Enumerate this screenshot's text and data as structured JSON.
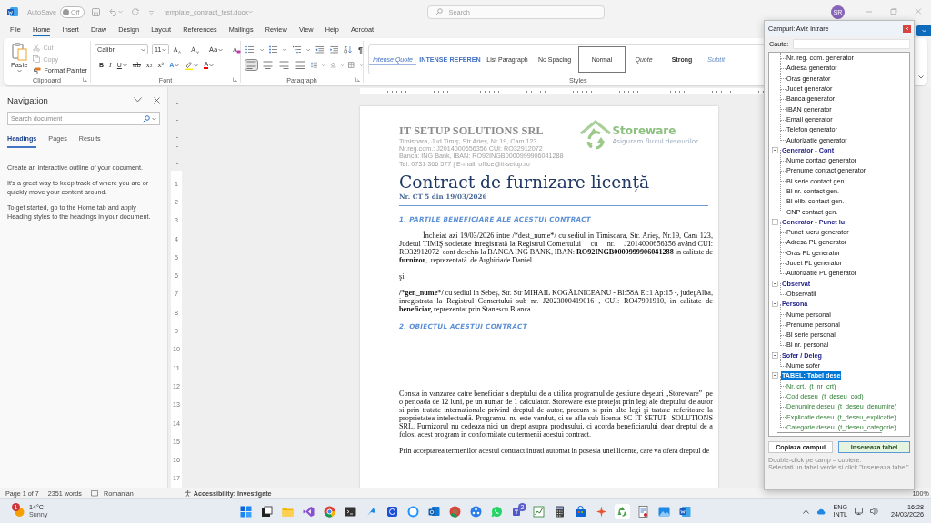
{
  "title_bar": {
    "autosave_label": "AutoSave",
    "autosave": {
      "label": "Off",
      "on": false
    },
    "file_name": "template_contract_test.docx",
    "search_placeholder": "Search",
    "avatar": "SR"
  },
  "menu_tabs": [
    {
      "label": "File",
      "selected": false
    },
    {
      "label": "Home",
      "selected": true
    },
    {
      "label": "Insert",
      "selected": false
    },
    {
      "label": "Draw",
      "selected": false
    },
    {
      "label": "Design",
      "selected": false
    },
    {
      "label": "Layout",
      "selected": false
    },
    {
      "label": "References",
      "selected": false
    },
    {
      "label": "Mailings",
      "selected": false
    },
    {
      "label": "Review",
      "selected": false
    },
    {
      "label": "View",
      "selected": false
    },
    {
      "label": "Help",
      "selected": false
    },
    {
      "label": "Acrobat",
      "selected": false
    }
  ],
  "ribbon": {
    "clipboard": {
      "paste": "Paste",
      "tools": [
        {
          "label": "Cut",
          "kind": "cut",
          "disabled": true
        },
        {
          "label": "Copy",
          "kind": "copy",
          "disabled": true
        },
        {
          "label": "Format Painter",
          "kind": "painter",
          "disabled": false
        }
      ],
      "group_label": "Clipboard"
    },
    "font": {
      "font_name": "Calibri",
      "font_size": "11",
      "tools": [
        {
          "label": "A",
          "kind": "grow"
        },
        {
          "label": "A",
          "kind": "shrink"
        },
        {
          "label": "Aa",
          "kind": "case"
        },
        {
          "label": "A",
          "kind": "clear"
        }
      ],
      "format": [
        {
          "label": "B",
          "kind": "bold"
        },
        {
          "label": "I",
          "kind": "italic"
        },
        {
          "label": "U",
          "kind": "underline"
        },
        {
          "label": "ab",
          "kind": "strike"
        },
        {
          "label": "x₂",
          "kind": "sub"
        },
        {
          "label": "x²",
          "kind": "sup"
        },
        {
          "label": "A",
          "kind": "effects"
        },
        {
          "kind": "highlight"
        },
        {
          "label": "A",
          "kind": "color"
        }
      ],
      "group_label": "Font"
    },
    "paragraph": {
      "pilcrow": "¶",
      "alignments": [
        {
          "kind": "left",
          "selected": true
        },
        {
          "kind": "center",
          "selected": false
        },
        {
          "kind": "right",
          "selected": false
        },
        {
          "kind": "justify",
          "selected": false
        }
      ],
      "group_label": "Paragraph"
    },
    "styles": {
      "items": [
        {
          "label": "Intense Quote",
          "kind": "intense-quote",
          "selected": false
        },
        {
          "label": "INTENSE REFEREN",
          "kind": "intense-reference",
          "selected": false
        },
        {
          "label": "List Paragraph",
          "kind": "plain",
          "selected": false
        },
        {
          "label": "No Spacing",
          "kind": "plain",
          "selected": false
        },
        {
          "label": "Normal",
          "kind": "plain",
          "selected": true
        },
        {
          "label": "Quote",
          "kind": "quote",
          "selected": false
        },
        {
          "label": "Strong",
          "kind": "strong",
          "selected": false
        },
        {
          "label": "Subtit",
          "kind": "subtitle",
          "selected": false
        }
      ],
      "group_label": "Styles"
    }
  },
  "navigation": {
    "title": "Navigation",
    "search_placeholder": "Search document",
    "tabs": [
      {
        "label": "Headings",
        "selected": true
      },
      {
        "label": "Pages",
        "selected": false
      },
      {
        "label": "Results",
        "selected": false
      }
    ],
    "paragraphs": [
      "Create an interactive outline of your document.",
      "It's a great way to keep track of where you are or quickly move your content around.",
      "To get started, go to the Home tab and apply Heading styles to the headings in your document."
    ]
  },
  "rulers": {
    "vertical_marks": [
      "1",
      "2",
      "3",
      "4",
      "5",
      "6",
      "7",
      "8",
      "9",
      "10",
      "11",
      "12",
      "13",
      "14",
      "15",
      "16",
      "17"
    ]
  },
  "document": {
    "company": {
      "name": "IT SETUP SOLUTIONS SRL",
      "lines": [
        "Timisoara, Jud Timiş, Str Arieş, Nr 19, Cam 123",
        "Nr.reg.com.: J2014000656356  CUI: RO32912072",
        "Banca: ING Bank,  IBAN:  RO92INGB0000999906041288",
        "Tel: 0731 366 577 | E-mail: office@it-setup.ro"
      ]
    },
    "logo": {
      "name": "Storeware",
      "tagline": "Asiguram fluxul deseurilor"
    },
    "title": "Contract de furnizare licență",
    "number": "Nr.  CT 5  din 19/03/2026",
    "blocks": [
      {
        "kind": "heading",
        "text": "1. PARTILE BENEFICIARE ALE ACESTUI CONTRACT"
      },
      {
        "kind": "paragraph",
        "indent": true,
        "runs": [
          {
            "text": "Încheiat azi 19/03/2026 intre /*dest_nume*/ cu sediul in Timisoara, Str. Arieş, Nr.19, Cam 123, Judetul TIMIŞ societate inregistrată la Registrul Comertului    cu    nr.    J2014000656356 având CUI: RO32912072  cont deschis la BANCA ING BANK, IBAN: ",
            "bold": false
          },
          {
            "text": "RO92INGB0000999906041288",
            "bold": true
          },
          {
            "text": " in calitate de ",
            "bold": false
          },
          {
            "text": "furnizor",
            "bold": true
          },
          {
            "text": ",  reprezentată  de Arghiriade Daniel",
            "bold": false
          }
        ]
      },
      {
        "kind": "paragraph",
        "indent": false,
        "runs": [
          {
            "text": "şi",
            "bold": false
          }
        ]
      },
      {
        "kind": "paragraph",
        "indent": false,
        "runs": [
          {
            "text": "/*gen_nume*/",
            "bold": true
          },
          {
            "text": " cu sediul in Sebeş, Str. Str MIHAIL KOGĂLNICEANU - Bl:58A Et:1 Ap:15 -, judeţ Alba, inregistrata la Registrul Comertului sub nr. J2023000419016 , CUI: RO47991910, in calitate de ",
            "bold": false
          },
          {
            "text": "beneficiar,",
            "bold": true
          },
          {
            "text": " reprezentat prin Stanescu Bianca.",
            "bold": false
          }
        ]
      },
      {
        "kind": "heading",
        "text": "2. OBIECTUL ACESTUI CONTRACT"
      },
      {
        "kind": "spacer"
      },
      {
        "kind": "paragraph",
        "indent": false,
        "runs": [
          {
            "text": "Consta in vanzarea catre beneficiar a dreptului de a utiliza programul de gestiune deşeuri „Storeware”  pe o perioada de 12 luni, pe un numar de 1 calculator. Storeware este protejat prin legi ale dreptului de autor si prin tratate internationale privind dreptul de autor, precum si prin alte legi şi tratate referitoare la proprietatea intelectuală. Programul nu este vandut, ci se afla sub licenta SC IT SETUP  SOLUTIONS SRL. Furnizorul nu cedeaza nici un drept asupra produsului, ci acorda beneficiarului doar dreptul de a folosi acest program in conformitate cu termenii acestui contract.",
            "bold": false
          }
        ]
      },
      {
        "kind": "paragraph",
        "indent": false,
        "runs": [
          {
            "text": "Prin acceptarea termenilor acestui contract intrati automat in posesia unei licente, care va ofera dreptul de",
            "bold": false
          }
        ]
      }
    ]
  },
  "dialog": {
    "title": "Campuri: Aviz intrare",
    "search_label": "Cauta:",
    "tree": [
      {
        "children": [
          {
            "label": "Nr. reg. com. generator",
            "kind": "field"
          },
          {
            "label": "Adresa generator",
            "kind": "field"
          },
          {
            "label": "Oras generator",
            "kind": "field"
          },
          {
            "label": "Judet generator",
            "kind": "field"
          },
          {
            "label": "Banca generator",
            "kind": "field"
          },
          {
            "label": "IBAN generator",
            "kind": "field"
          },
          {
            "label": "Email generator",
            "kind": "field"
          },
          {
            "label": "Telefon generator",
            "kind": "field"
          },
          {
            "label": "Autorizatie generator",
            "kind": "field"
          }
        ]
      },
      {
        "label": "Generator - Cont",
        "expanded": true,
        "selected": false,
        "children": [
          {
            "label": "Nume contact generator",
            "kind": "field"
          },
          {
            "label": "Prenume contact generator",
            "kind": "field"
          },
          {
            "label": "BI serie contact gen.",
            "kind": "field"
          },
          {
            "label": "BI nr. contact gen.",
            "kind": "field"
          },
          {
            "label": "BI elib. contact gen.",
            "kind": "field"
          },
          {
            "label": "CNP contact gen.",
            "kind": "field"
          }
        ]
      },
      {
        "label": "Generator - Punct lu",
        "expanded": true,
        "selected": false,
        "children": [
          {
            "label": "Punct lucru generator",
            "kind": "field"
          },
          {
            "label": "Adresa PL generator",
            "kind": "field"
          },
          {
            "label": "Oras PL generator",
            "kind": "field"
          },
          {
            "label": "Judet PL generator",
            "kind": "field"
          },
          {
            "label": "Autorizatie PL generator",
            "kind": "field"
          }
        ]
      },
      {
        "label": "Observat",
        "expanded": true,
        "selected": false,
        "children": [
          {
            "label": "Observatii",
            "kind": "field"
          }
        ]
      },
      {
        "label": "Persona",
        "expanded": true,
        "selected": false,
        "children": [
          {
            "label": "Nume personal",
            "kind": "field"
          },
          {
            "label": "Prenume personal",
            "kind": "field"
          },
          {
            "label": "BI serie personal",
            "kind": "field"
          },
          {
            "label": "BI nr. personal",
            "kind": "field"
          }
        ]
      },
      {
        "label": "Sofer / Deleg",
        "expanded": true,
        "selected": false,
        "children": [
          {
            "label": "Nume sofer",
            "kind": "field"
          }
        ]
      },
      {
        "label": "TABEL: Tabel dese",
        "expanded": true,
        "selected": true,
        "children": [
          {
            "label": "Nr. crt.  (t_nr_crt)",
            "kind": "table-field"
          },
          {
            "label": "Cod deseu  (t_deseu_cod)",
            "kind": "table-field"
          },
          {
            "label": "Denumire deseu  (t_deseu_denumire)",
            "kind": "table-field"
          },
          {
            "label": "Explicatie deseu  (t_deseu_explicatie)",
            "kind": "table-field"
          },
          {
            "label": "Categorie deseu  (t_deseu_categorie)",
            "kind": "table-field"
          }
        ]
      }
    ],
    "buttons": [
      {
        "label": "Copiaza campul",
        "kind": "plain"
      },
      {
        "label": "Insereaza tabel",
        "kind": "primary"
      }
    ],
    "hints": [
      "Double-click pe camp = copiere.",
      "Selectati un tabel verde si click \"Insereaza tabel\"."
    ]
  },
  "status_bar": {
    "page": "Page 1 of 7",
    "words": "2351 words",
    "language": "Romanian",
    "accessibility": "Accessibility: Investigate",
    "zoom": "100%"
  },
  "taskbar": {
    "weather": {
      "temperature": "14°C",
      "condition": "Sunny",
      "badge": "1"
    },
    "app_badge": "2",
    "tray": {
      "language": "ENG",
      "layout": "INTL",
      "time": "16:28",
      "date": "24/03/2026"
    }
  }
}
